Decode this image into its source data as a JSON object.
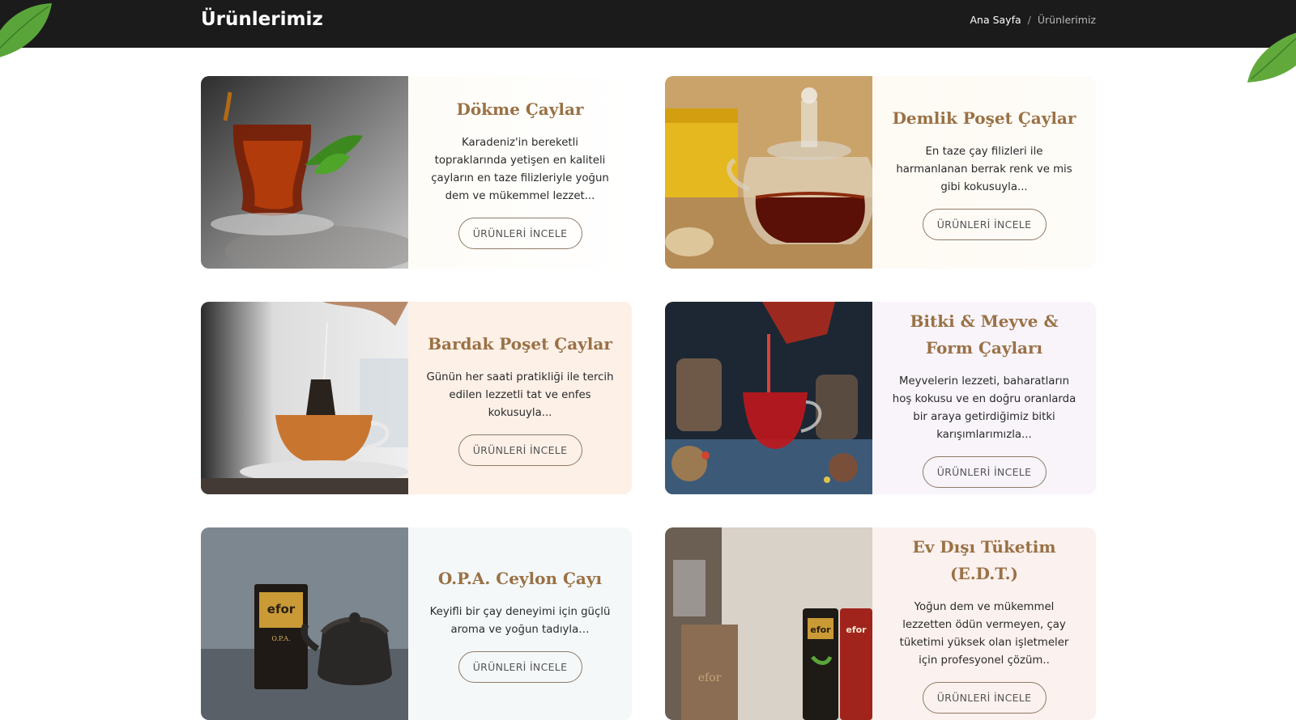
{
  "header": {
    "title": "Ürünlerimiz",
    "breadcrumb": {
      "home": "Ana Sayfa",
      "separator": "/",
      "current": "Ürünlerimiz"
    }
  },
  "products": [
    {
      "title": "Dökme Çaylar",
      "description": "Karadeniz'in bereketli topraklarında yetişen en kaliteli çayların en taze filizleriyle yoğun dem ve mükemmel lezzet...",
      "button": "ÜRÜNLERİ İNCELE"
    },
    {
      "title": "Demlik Poşet Çaylar",
      "description": "En taze çay filizleri ile harmanlanan berrak renk ve mis gibi kokusuyla...",
      "button": "ÜRÜNLERİ İNCELE"
    },
    {
      "title": "Bardak Poşet Çaylar",
      "description": "Günün her saati pratikliği ile tercih edilen lezzetli tat ve enfes kokusuyla...",
      "button": "ÜRÜNLERİ İNCELE"
    },
    {
      "title": "Bitki & Meyve & Form Çayları",
      "description": "Meyvelerin lezzeti, baharatların hoş kokusu ve en doğru oranlarda bir araya getirdiğimiz bitki karışımlarımızla...",
      "button": "ÜRÜNLERİ İNCELE"
    },
    {
      "title": "O.P.A. Ceylon Çayı",
      "description": "Keyifli bir çay deneyimi için güçlü aroma ve yoğun tadıyla…",
      "button": "ÜRÜNLERİ İNCELE"
    },
    {
      "title": "Ev Dışı Tüketim (E.D.T.)",
      "description": "Yoğun dem ve mükemmel lezzetten ödün vermeyen, çay tüketimi yüksek olan işletmeler için profesyonel çözüm..",
      "button": "ÜRÜNLERİ İNCELE"
    }
  ],
  "photo_labels": {
    "brand": "efor",
    "opa_pack": "O.P.A."
  },
  "colors": {
    "header_bg": "#1b1b1b",
    "title_gold": "#9a7145",
    "leaf_green": "#5aa53a"
  },
  "icons": [
    "leaf-icon"
  ]
}
